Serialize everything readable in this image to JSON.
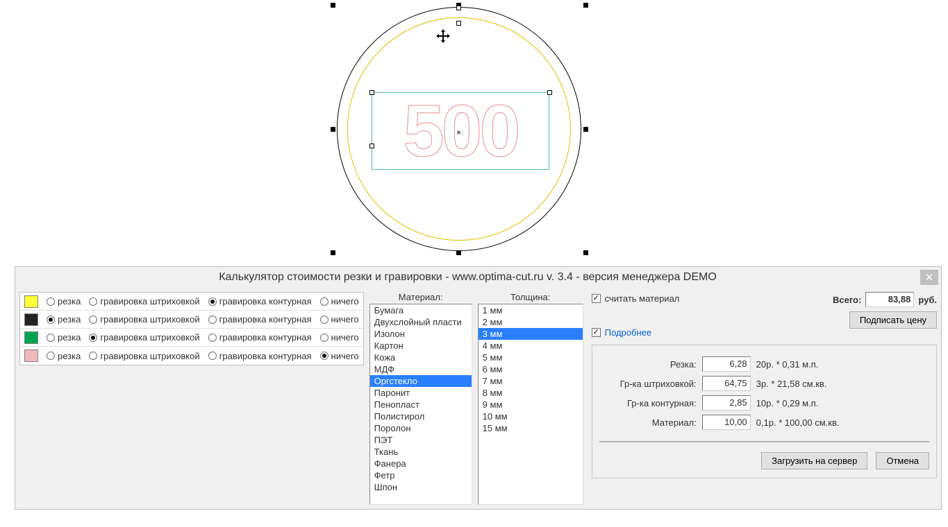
{
  "canvas": {
    "text_value": "500"
  },
  "dialog": {
    "title": "Калькулятор стоимости резки и гравировки - www.optima-cut.ru v. 3.4 - версия менеджера DEMO",
    "color_options": {
      "rezka": "резка",
      "grav_shtr": "гравировка штриховкой",
      "grav_kont": "гравировка контурная",
      "nichego": "ничего"
    },
    "rows": [
      {
        "color": "#ffff39",
        "selected": "grav_kont"
      },
      {
        "color": "#242424",
        "selected": "rezka"
      },
      {
        "color": "#00a651",
        "selected": "grav_shtr"
      },
      {
        "color": "#f0b9ba",
        "selected": "nichego"
      }
    ],
    "material_header": "Материал:",
    "thickness_header": "Толщина:",
    "materials": [
      "Бумага",
      "Двухслойный пласти",
      "Изолон",
      "Картон",
      "Кожа",
      "МДФ",
      "Оргстекло",
      "Паронит",
      "Пенопласт",
      "Полистирол",
      "Поролон",
      "ПЭТ",
      "Ткань",
      "Фанера",
      "Фетр",
      "Шпон"
    ],
    "material_selected_index": 6,
    "thicknesses": [
      "1 мм",
      "2 мм",
      "3 мм",
      "4 мм",
      "5 мм",
      "6 мм",
      "7 мм",
      "8 мм",
      "9 мм",
      "10 мм",
      "15 мм"
    ],
    "thickness_selected_index": 2,
    "count_material_label": "считать материал",
    "more_label": "Подробнее",
    "total_label": "Всего:",
    "total_value": "83,88",
    "total_unit": "руб.",
    "sign_price_btn": "Подписать цену",
    "details": {
      "rezka": {
        "label": "Резка:",
        "value": "6,28",
        "desc": "20р. * 0,31 м.п."
      },
      "shtr": {
        "label": "Гр-ка штриховкой:",
        "value": "64,75",
        "desc": "3р. * 21,58 см.кв."
      },
      "kont": {
        "label": "Гр-ка контурная:",
        "value": "2,85",
        "desc": "10р. * 0,29 м.п."
      },
      "material": {
        "label": "Материал:",
        "value": "10,00",
        "desc": "0,1р. * 100,00 см.кв."
      }
    },
    "upload_btn": "Загрузить на сервер",
    "cancel_btn": "Отмена"
  }
}
